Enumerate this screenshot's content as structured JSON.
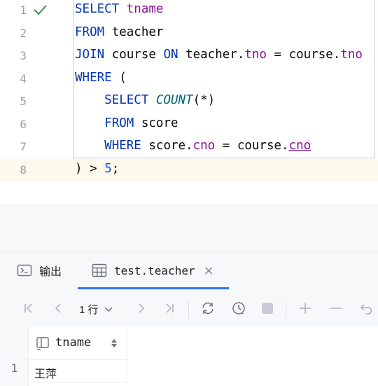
{
  "editor": {
    "lines": [
      {
        "n": "1",
        "tokens": [
          {
            "t": "SELECT",
            "c": "kw"
          },
          {
            "t": " "
          },
          {
            "t": "tname",
            "c": "fld"
          }
        ]
      },
      {
        "n": "2",
        "tokens": [
          {
            "t": "FROM",
            "c": "kw"
          },
          {
            "t": " teacher"
          }
        ]
      },
      {
        "n": "3",
        "tokens": [
          {
            "t": "JOIN",
            "c": "kw"
          },
          {
            "t": " course "
          },
          {
            "t": "ON",
            "c": "kw"
          },
          {
            "t": " teacher."
          },
          {
            "t": "tno",
            "c": "fld"
          },
          {
            "t": " = course."
          },
          {
            "t": "tno",
            "c": "fld"
          }
        ]
      },
      {
        "n": "4",
        "tokens": [
          {
            "t": "WHERE",
            "c": "kw"
          },
          {
            "t": " ("
          }
        ]
      },
      {
        "n": "5",
        "tokens": [
          {
            "t": "    "
          },
          {
            "t": "SELECT",
            "c": "kw"
          },
          {
            "t": " "
          },
          {
            "t": "COUNT",
            "c": "fn"
          },
          {
            "t": "(*)"
          }
        ]
      },
      {
        "n": "6",
        "tokens": [
          {
            "t": "    "
          },
          {
            "t": "FROM",
            "c": "kw"
          },
          {
            "t": " score"
          }
        ]
      },
      {
        "n": "7",
        "tokens": [
          {
            "t": "    "
          },
          {
            "t": "WHERE",
            "c": "kw"
          },
          {
            "t": " score."
          },
          {
            "t": "cno",
            "c": "fld"
          },
          {
            "t": " = course."
          },
          {
            "t": "cno",
            "c": "fld ul"
          }
        ]
      },
      {
        "n": "8",
        "tokens": [
          {
            "t": ") > "
          },
          {
            "t": "5",
            "c": "num"
          },
          {
            "t": ";"
          }
        ]
      }
    ],
    "check_icon": "check-icon",
    "check_color": "#499c54"
  },
  "tabs": {
    "output_label": "输出",
    "table_label": "test.teacher",
    "close_glyph": "×"
  },
  "toolbar": {
    "row_count": "1 行"
  },
  "grid": {
    "column_name": "tname",
    "rows": [
      {
        "num": "1",
        "tname": "王萍"
      }
    ]
  },
  "colors": {
    "keyword": "#0033b3",
    "field": "#871094",
    "accent": "#3574f0"
  }
}
